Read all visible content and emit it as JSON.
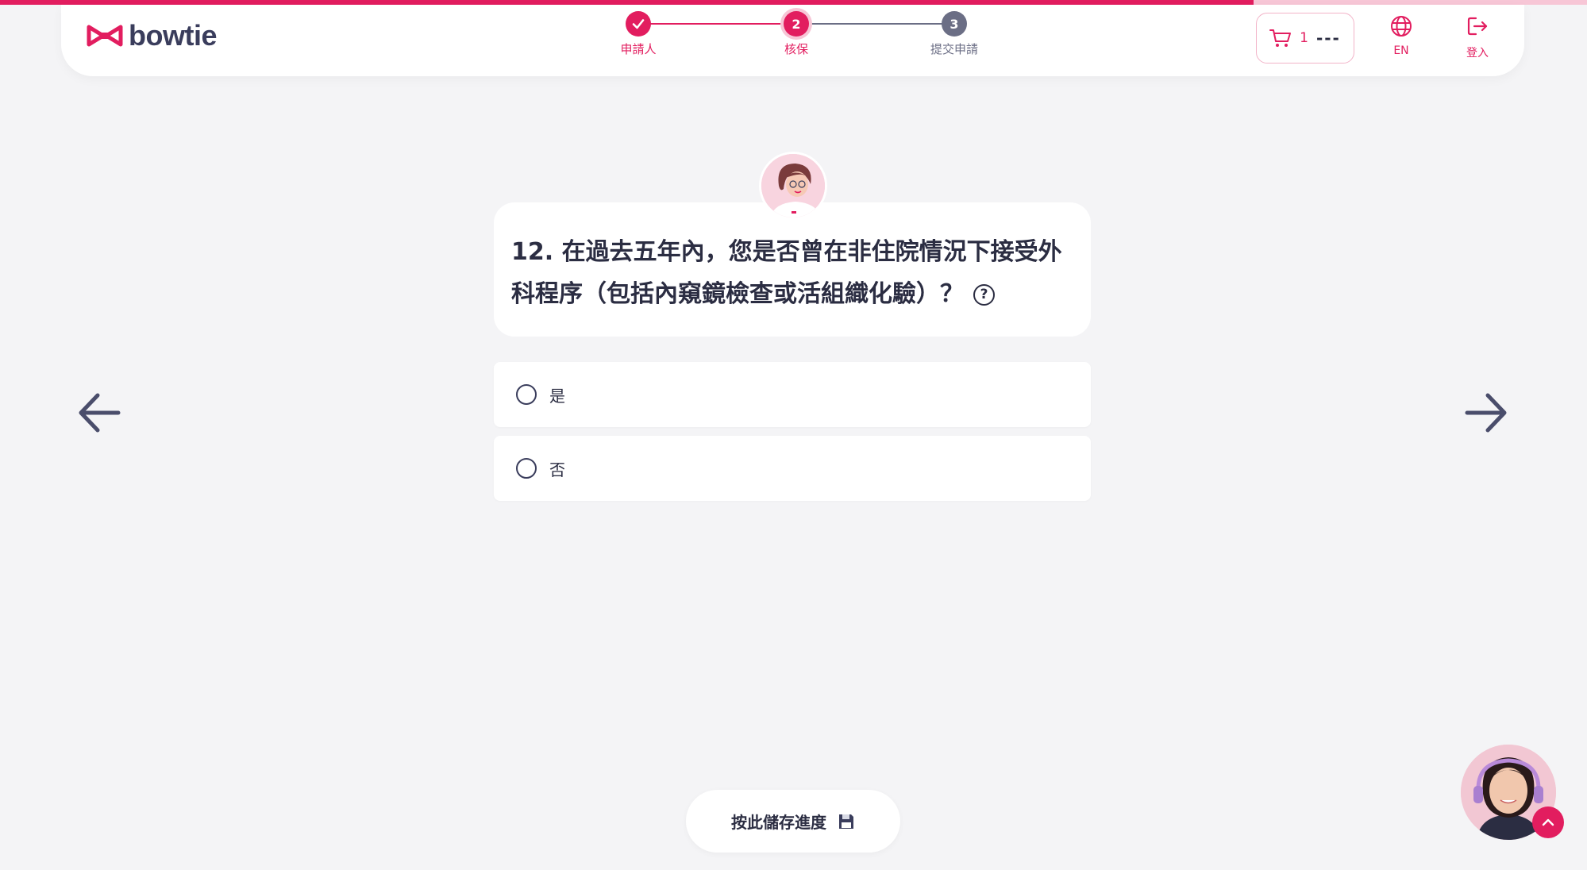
{
  "progress": {
    "percent": 79
  },
  "brand": {
    "name": "bowtie",
    "accent_color": "#e21d5f",
    "text_color": "#3a3d5c"
  },
  "stepper": {
    "steps": [
      {
        "label": "申請人",
        "number": "1",
        "state": "completed",
        "icon": "check-icon"
      },
      {
        "label": "核保",
        "number": "2",
        "state": "current"
      },
      {
        "label": "提交申請",
        "number": "3",
        "state": "upcoming"
      }
    ]
  },
  "header": {
    "cart": {
      "count": "1",
      "price": "---",
      "icon": "cart-icon"
    },
    "language": {
      "label": "EN",
      "icon": "globe-icon"
    },
    "login": {
      "label": "登入",
      "icon": "login-icon"
    }
  },
  "question": {
    "text": "12. 在過去五年內，您是否曾在非住院情況下接受外科程序（包括內窺鏡檢查或活組織化驗）？",
    "help_icon": "question-mark-icon",
    "help_glyph": "?",
    "options": [
      {
        "label": "是",
        "selected": false
      },
      {
        "label": "否",
        "selected": false
      }
    ]
  },
  "navigation": {
    "prev_icon": "arrow-left-icon",
    "next_icon": "arrow-right-icon"
  },
  "save": {
    "label": "按此儲存進度",
    "icon": "floppy-disk-icon"
  },
  "chat": {
    "icon": "chevron-up-icon"
  }
}
